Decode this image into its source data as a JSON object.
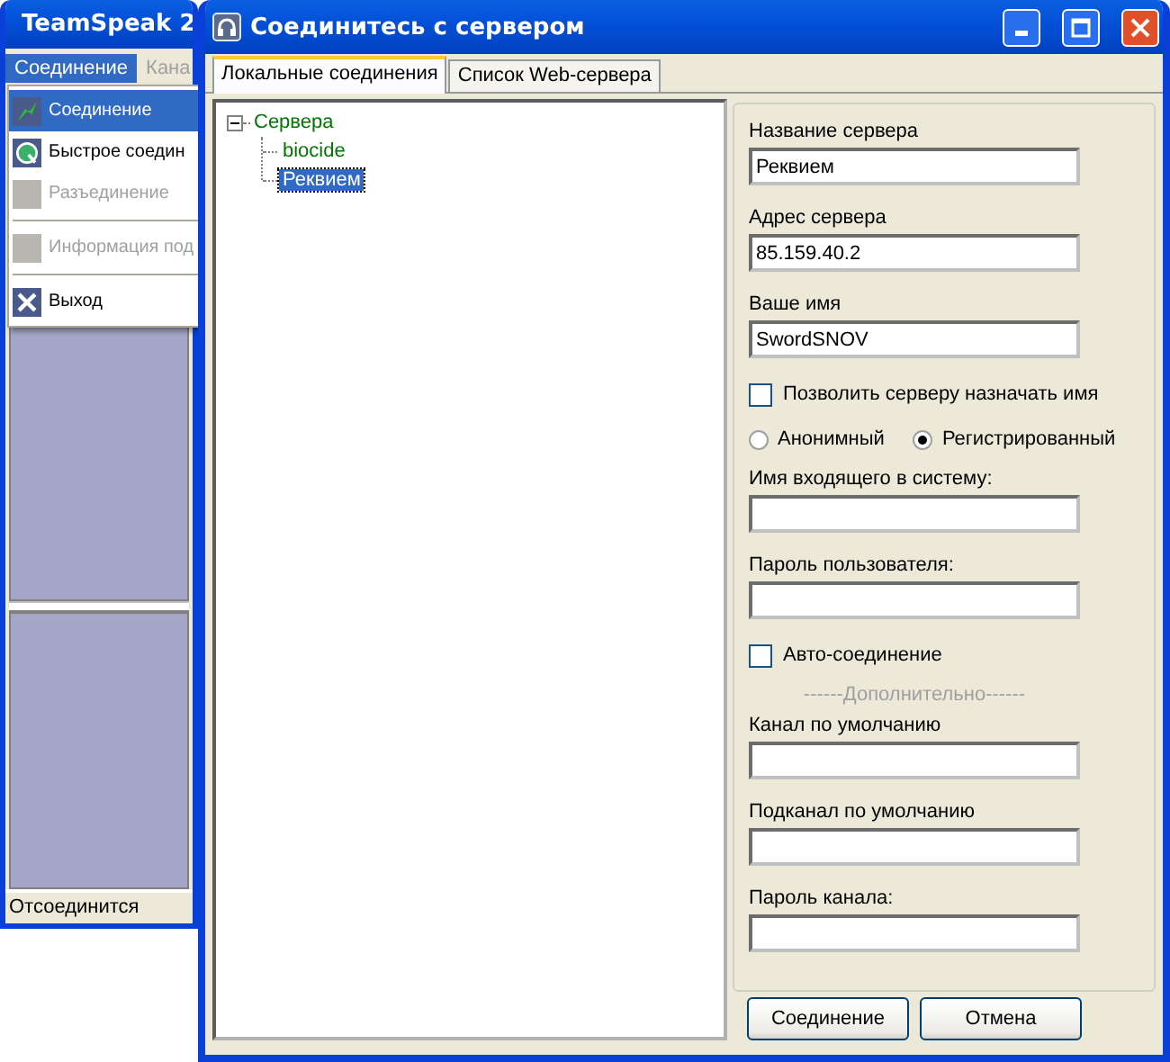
{
  "background_window": {
    "title": "TeamSpeak 2",
    "menu": [
      {
        "label": "Соединение",
        "selected": true
      },
      {
        "label": "Кана",
        "selected": false
      }
    ],
    "dropdown": [
      {
        "kind": "item",
        "label": "Соединение",
        "highlighted": true,
        "disabled": false
      },
      {
        "kind": "item",
        "label": "Быстрое соедин",
        "highlighted": false,
        "disabled": false
      },
      {
        "kind": "item",
        "label": "Разъединение",
        "highlighted": false,
        "disabled": true
      },
      {
        "kind": "separator"
      },
      {
        "kind": "item",
        "label": "Информация под",
        "highlighted": false,
        "disabled": true
      },
      {
        "kind": "separator"
      },
      {
        "kind": "item",
        "label": "Выход",
        "highlighted": false,
        "disabled": false
      }
    ],
    "status_bar": "Отсоединится"
  },
  "dialog": {
    "title": "Соединитесь с сервером",
    "tabs": [
      {
        "label": "Локальные соединения",
        "selected": true
      },
      {
        "label": "Список Web-сервера",
        "selected": false
      }
    ],
    "tree": {
      "label": "Сервера",
      "expanded": true,
      "children": [
        {
          "label": "biocide",
          "selected": false
        },
        {
          "label": "Реквием",
          "selected": true
        }
      ]
    },
    "form": [
      {
        "kind": "field",
        "label": "Название сервера",
        "value": "Реквием"
      },
      {
        "kind": "field",
        "label": "Адрес сервера",
        "value": "85.159.40.2"
      },
      {
        "kind": "field",
        "label": "Ваше имя",
        "value": "SwordSNOV"
      },
      {
        "kind": "checkbox",
        "label": "Позволить серверу назначать имя",
        "checked": false
      },
      {
        "kind": "radios",
        "options": [
          {
            "label": "Анонимный",
            "selected": false
          },
          {
            "label": "Регистрированный",
            "selected": true
          }
        ]
      },
      {
        "kind": "field",
        "label": "Имя входящего в систему:"
      },
      {
        "kind": "field",
        "label": "Пароль пользователя:"
      },
      {
        "kind": "checkbox",
        "label": "Авто-соединение",
        "checked": false
      },
      {
        "kind": "divider",
        "label": "------Дополнительно------"
      },
      {
        "kind": "field",
        "label": "Канал по умолчанию"
      },
      {
        "kind": "field",
        "label": "Подканал по умолчанию"
      },
      {
        "kind": "field",
        "label": "Пароль канала:"
      }
    ],
    "buttons": [
      "Соединение",
      "Отмена"
    ]
  }
}
